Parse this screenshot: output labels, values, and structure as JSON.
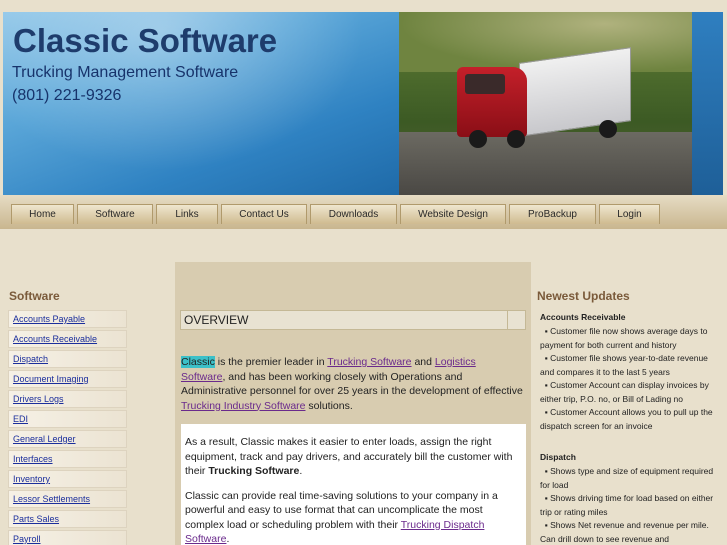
{
  "header": {
    "title": "Classic Software",
    "subtitle": "Trucking Management Software",
    "phone": "(801) 221-9326"
  },
  "nav": [
    {
      "label": "Home"
    },
    {
      "label": "Software"
    },
    {
      "label": "Links"
    },
    {
      "label": "Contact Us"
    },
    {
      "label": "Downloads"
    },
    {
      "label": "Website Design"
    },
    {
      "label": "ProBackup"
    },
    {
      "label": "Login"
    }
  ],
  "sidebar": {
    "title": "Software",
    "items": [
      "Accounts Payable",
      "Accounts Receivable",
      "Dispatch",
      "Document Imaging",
      "Drivers Logs",
      "EDI",
      "General Ledger",
      "Interfaces",
      "Inventory",
      "Lessor Settlements",
      "Parts Sales",
      "Payroll"
    ]
  },
  "main": {
    "overview_label": "OVERVIEW",
    "intro": {
      "brand": "Classic",
      "t1": " is the premier leader in ",
      "link1": "Trucking Software",
      "t2": " and ",
      "link2": "Logistics Software",
      "t3": ", and has been working closely with Operations and Administrative personnel for over 25 years in the development of effective ",
      "link3": "Trucking Industry Software",
      "t4": " solutions."
    },
    "para2": {
      "text": "As a result, Classic makes it easier to enter loads, assign the right equipment, track and pay drivers, and accurately bill the customer with their ",
      "bold": "Trucking Software",
      "end": "."
    },
    "para3": {
      "text": "Classic can provide real time-saving solutions to your company in a powerful and easy to use format that can uncomplicate the most complex load or scheduling problem with their ",
      "link": "Trucking Dispatch Software",
      "end": "."
    }
  },
  "updates": {
    "title": "Newest Updates",
    "ar_head": "Accounts Receivable",
    "ar_items": [
      "Customer file now shows average days to payment for both current and history",
      "Customer file shows year-to-date revenue and compares it to the last 5 years",
      "Customer Account can display invoices by either trip, P.O. no, or Bill of Lading no",
      "Customer Account allows you to pull up the dispatch screen for an invoice"
    ],
    "dispatch_head": "Dispatch",
    "dispatch_items": [
      "Shows type and size of equipment required for load",
      "Shows driving time for load based on either trip or rating miles",
      "Shows Net revenue and revenue per mile. Can drill down to see revenue and"
    ]
  },
  "colors": {
    "banner_blue": "#2f82c2",
    "title_navy": "#1e3c6c",
    "link_blue": "#1b2e9c",
    "link_visited": "#6a2a8c",
    "highlight": "#3cc0c8",
    "section_brown": "#7a5a3a"
  }
}
